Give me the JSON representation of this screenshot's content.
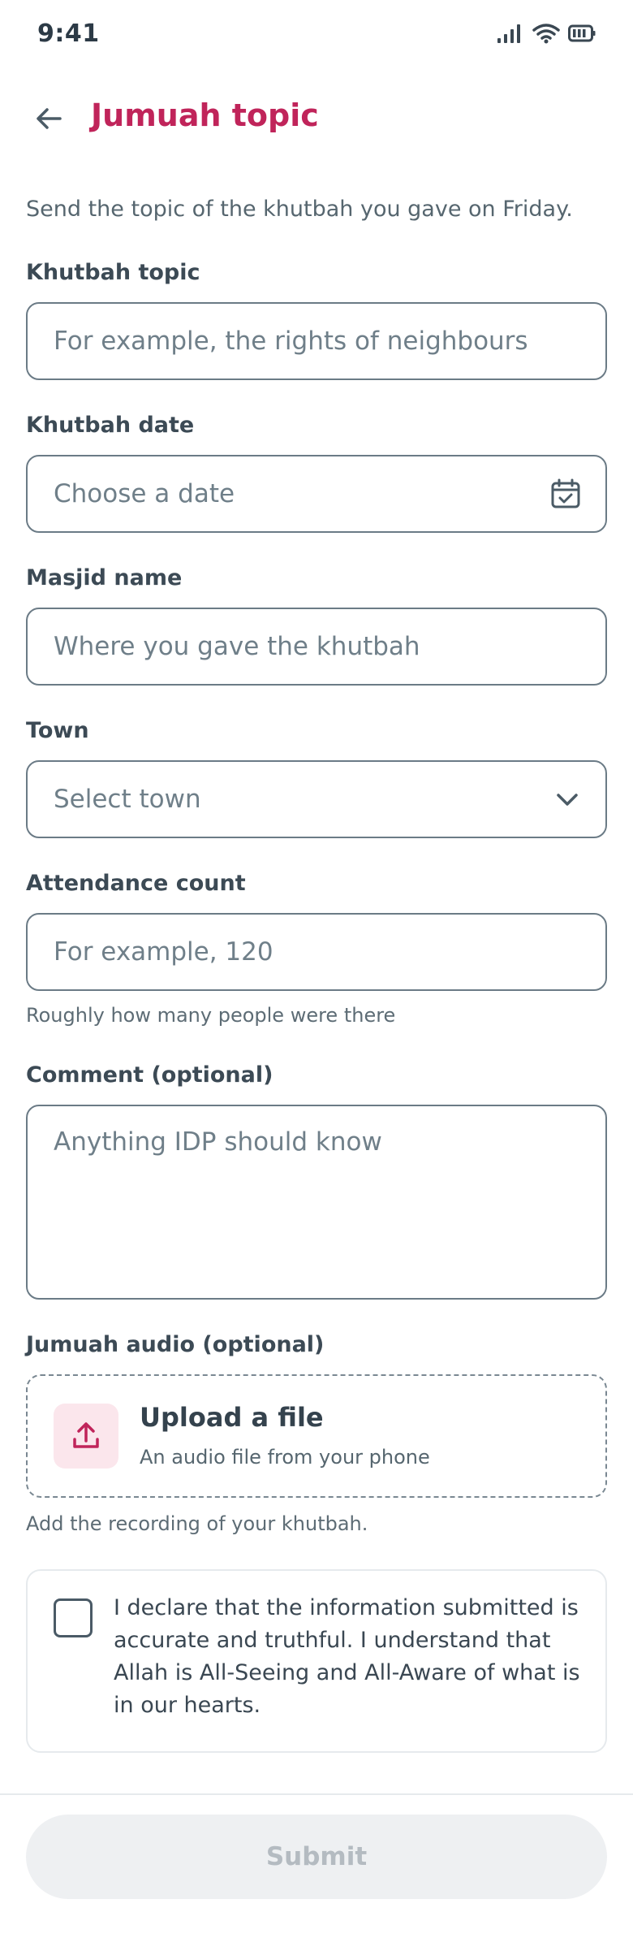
{
  "status_bar": {
    "time": "9:41"
  },
  "header": {
    "title": "Jumuah topic"
  },
  "intro": "Send the topic of the khutbah you gave on Friday.",
  "fields": {
    "topic": {
      "label": "Khutbah topic",
      "placeholder": "For example, the rights of neighbours"
    },
    "date": {
      "label": "Khutbah date",
      "placeholder": "Choose a date",
      "icon": "calendar-icon"
    },
    "masjid": {
      "label": "Masjid name",
      "placeholder": "Where you gave the khutbah"
    },
    "town": {
      "label": "Town",
      "placeholder": "Select town",
      "icon": "chevron-down-icon"
    },
    "attendance": {
      "label": "Attendance count",
      "placeholder": "For example, 120",
      "helper": "Roughly how many people were there"
    },
    "comment": {
      "label": "Comment (optional)",
      "placeholder": "Anything IDP should know"
    }
  },
  "audio": {
    "label": "Jumuah audio (optional)",
    "upload_title": "Upload a file",
    "upload_subtitle": "An audio file from your phone",
    "helper": "Add the recording of your khutbah."
  },
  "declaration": {
    "checked": false,
    "text": "I declare that the information submitted is accurate and truthful. I understand that Allah is All-Seeing and All-Aware of what is in our hearts."
  },
  "submit_label": "Submit",
  "colors": {
    "accent": "#c0245a",
    "border": "#6b7b86",
    "disabled_bg": "#eef0f2",
    "disabled_text": "#b4bbc1"
  }
}
